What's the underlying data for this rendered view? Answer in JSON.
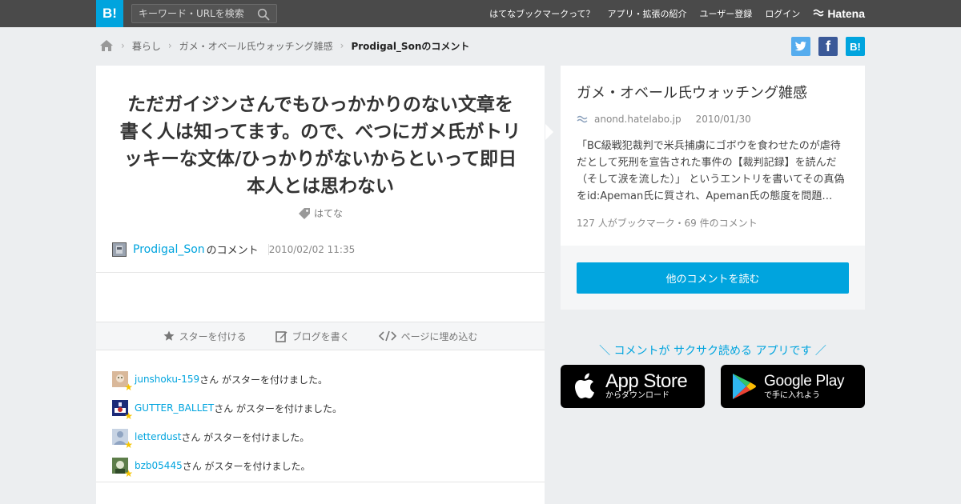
{
  "header": {
    "logo": "B!",
    "search_placeholder": "キーワード・URLを検索",
    "nav": [
      "はてなブックマークって？",
      "アプリ・拡張の紹介",
      "ユーザー登録",
      "ログイン"
    ],
    "brand": "Hatena"
  },
  "breadcrumb": {
    "items": [
      "暮らし",
      "ガメ・オベール氏ウォッチング雑感",
      "Prodigal_Sonのコメント"
    ]
  },
  "share": {
    "twitter": "t",
    "facebook": "f",
    "hatena": "B!",
    "colors": {
      "twitter": "#55acee",
      "facebook": "#3b5998",
      "hatena": "#00a4de"
    }
  },
  "comment": {
    "text": "ただガイジンさんでもひっかかりのない文章を書く人は知ってます。ので、べつにガメ氏がトリッキーな文体/ひっかりがないからといって即日本人とは思わない",
    "tag": "はてな",
    "user": "Prodigal_Son",
    "user_suffix": "のコメント",
    "date": "2010/02/02 11:35"
  },
  "actions": {
    "star": "スターを付ける",
    "blog": "ブログを書く",
    "embed": "ページに埋め込む"
  },
  "stars": [
    {
      "user": "junshoku-159",
      "text": "さん がスターを付けました。"
    },
    {
      "user": "GUTTER_BALLET",
      "text": "さん がスターを付けました。"
    },
    {
      "user": "letterdust",
      "text": "さん がスターを付けました。"
    },
    {
      "user": "bzb05445",
      "text": "さん がスターを付けました。"
    }
  ],
  "entry": {
    "title": "ガメ・オベール氏ウォッチング雑感",
    "domain": "anond.hatelabo.jp",
    "date": "2010/01/30",
    "body": "「BC級戦犯裁判で米兵捕虜にゴボウを食わせたのが虐待だとして死刑を宣告された事件の【裁判記録】を読んだ（そして涙を流した）」 というエントリを書いてその真偽をid:Apeman氏に質され、Apeman氏の態度を問題…",
    "stats": "127 人がブックマーク・69 件のコメント",
    "read_more": "他のコメントを読む"
  },
  "app": {
    "promo": "＼ コメントが サクサク読める アプリです ／",
    "appstore_big": "App Store",
    "appstore_small": "からダウンロード",
    "gplay_big": "Google Play",
    "gplay_small": "で手に入れよう"
  },
  "colors": {
    "accent": "#00a4de",
    "topbar": "#4a4a4a",
    "background": "#eceef0"
  }
}
